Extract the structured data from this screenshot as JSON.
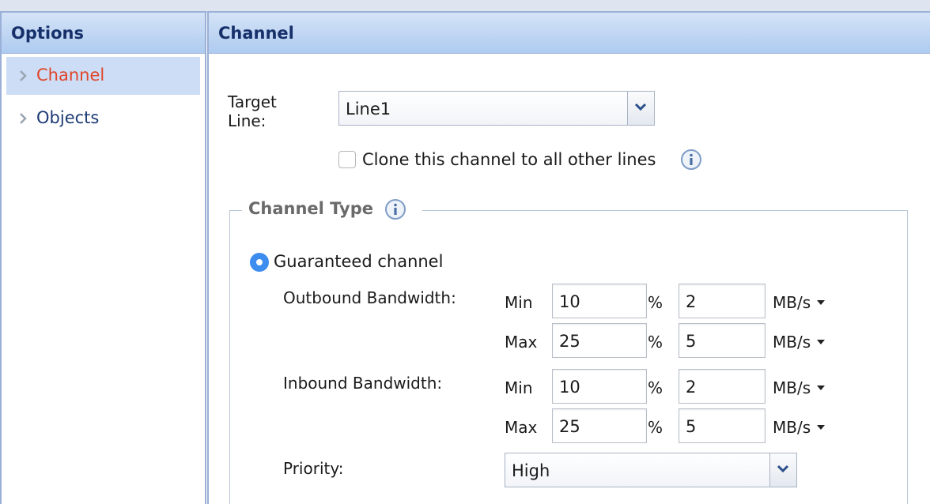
{
  "sidebar": {
    "title": "Options",
    "items": [
      {
        "label": "Channel",
        "active": true
      },
      {
        "label": "Objects",
        "active": false
      }
    ]
  },
  "main": {
    "title": "Channel",
    "target_line": {
      "label_line1": "Target",
      "label_line2": "Line:",
      "value": "Line1"
    },
    "clone": {
      "label": "Clone this channel to all other lines",
      "checked": false
    },
    "channel_type": {
      "legend": "Channel Type",
      "option": "Guaranteed channel",
      "outbound": {
        "label": "Outbound Bandwidth:",
        "min": {
          "label": "Min",
          "percent": "10",
          "percent_sym": "%",
          "value": "2",
          "unit": "MB/s"
        },
        "max": {
          "label": "Max",
          "percent": "25",
          "percent_sym": "%",
          "value": "5",
          "unit": "MB/s"
        }
      },
      "inbound": {
        "label": "Inbound Bandwidth:",
        "min": {
          "label": "Min",
          "percent": "10",
          "percent_sym": "%",
          "value": "2",
          "unit": "MB/s"
        },
        "max": {
          "label": "Max",
          "percent": "25",
          "percent_sym": "%",
          "value": "5",
          "unit": "MB/s"
        }
      },
      "priority": {
        "label": "Priority:",
        "value": "High"
      }
    }
  },
  "colors": {
    "header_gradient_top": "#d5e3f7",
    "header_gradient_bottom": "#aecbf0",
    "active_nav": "#ccddf5",
    "active_text": "#e0452a",
    "radio": "#3d8cf0"
  },
  "icons": [
    "chevron-right-icon",
    "chevron-down-icon",
    "info-icon",
    "unit-caret-icon"
  ]
}
